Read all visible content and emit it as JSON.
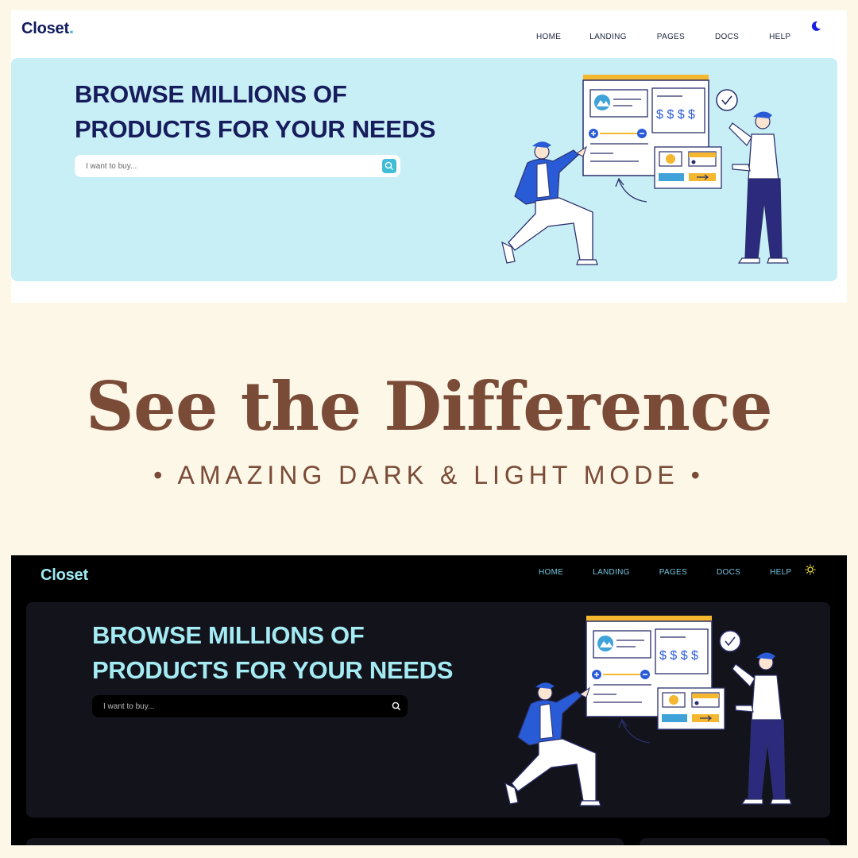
{
  "colors": {
    "page_bg": "#fdf7e8",
    "light_hero": "#c8eff6",
    "light_headline": "#171c5c",
    "accent_cyan": "#41bdd8",
    "dark_bg": "#000000",
    "dark_hero": "#13131c",
    "dark_headline": "#a5ebf3",
    "title_brown": "#7a4b37",
    "illustration_blue": "#2a5bd7",
    "illustration_yellow": "#f5b72e"
  },
  "light": {
    "brand": "Closet",
    "brand_dot": ".",
    "nav": [
      "HOME",
      "LANDING",
      "PAGES",
      "DOCS",
      "HELP"
    ],
    "theme_toggle_icon": "moon-icon",
    "headline_line1": "BROWSE MILLIONS OF",
    "headline_line2": "PRODUCTS FOR YOUR NEEDS",
    "search_placeholder": "I want to buy...",
    "search_icon": "search-icon"
  },
  "title": "See the Difference",
  "subtitle": "• AMAZING DARK & LIGHT MODE •",
  "dark": {
    "brand": "Closet",
    "brand_dot": ".",
    "nav": [
      "HOME",
      "LANDING",
      "PAGES",
      "DOCS",
      "HELP"
    ],
    "theme_toggle_icon": "sun-icon",
    "headline_line1": "BROWSE MILLIONS OF",
    "headline_line2": "PRODUCTS FOR YOUR NEEDS",
    "search_placeholder": "I want to buy...",
    "search_icon": "search-icon"
  },
  "illustration": {
    "currency_text": "$ $ $ $",
    "coin_symbol": "$"
  }
}
